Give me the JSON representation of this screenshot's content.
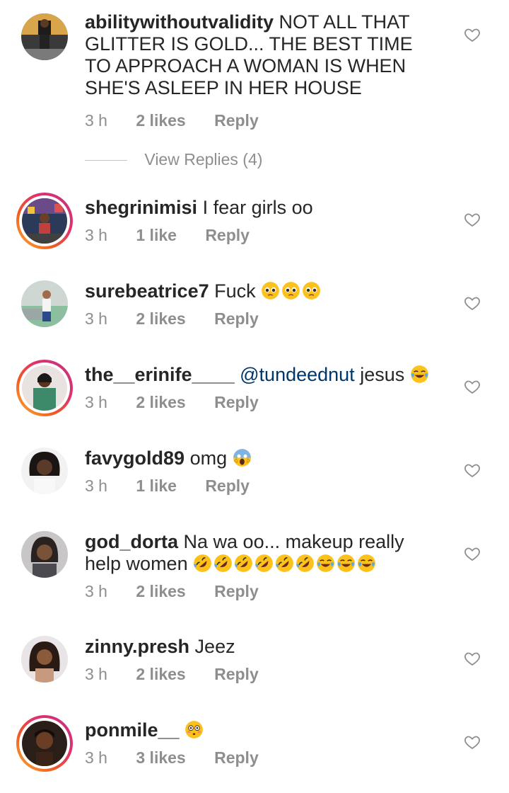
{
  "comments": [
    {
      "username": "abilitywithoutvalidity",
      "text": "NOT ALL THAT GLITTER IS GOLD... THE BEST TIME TO APPROACH A WOMAN IS WHEN SHE'S ASLEEP IN HER HOUSE",
      "time": "3 h",
      "likes": "2 likes",
      "reply": "Reply",
      "view_replies": "View Replies (4)"
    },
    {
      "username": "shegrinimisi",
      "text": "I fear girls oo",
      "time": "3 h",
      "likes": "1 like",
      "reply": "Reply"
    },
    {
      "username": "surebeatrice7",
      "text": "Fuck",
      "emojis": [
        "pleading-face",
        "pleading-face",
        "pleading-face"
      ],
      "time": "3 h",
      "likes": "2 likes",
      "reply": "Reply"
    },
    {
      "username": "the__erinife____",
      "mention": "@tundeednut",
      "text": "jesus",
      "emojis": [
        "tears-of-joy"
      ],
      "time": "3 h",
      "likes": "2 likes",
      "reply": "Reply"
    },
    {
      "username": "favygold89",
      "text": "omg",
      "emojis": [
        "screaming-face"
      ],
      "time": "3 h",
      "likes": "1 like",
      "reply": "Reply"
    },
    {
      "username": "god_dorta",
      "text": "Na wa oo... makeup really help women",
      "emojis": [
        "rolling-laughing",
        "rolling-laughing",
        "rolling-laughing",
        "rolling-laughing",
        "rolling-laughing",
        "rolling-laughing",
        "tears-of-joy",
        "tears-of-joy",
        "tears-of-joy"
      ],
      "time": "3 h",
      "likes": "2 likes",
      "reply": "Reply"
    },
    {
      "username": "zinny.presh",
      "text": "Jeez",
      "time": "3 h",
      "likes": "2 likes",
      "reply": "Reply"
    },
    {
      "username": "ponmile__",
      "text": "",
      "emojis": [
        "flushed-face"
      ],
      "time": "3 h",
      "likes": "3 likes",
      "reply": "Reply"
    }
  ]
}
